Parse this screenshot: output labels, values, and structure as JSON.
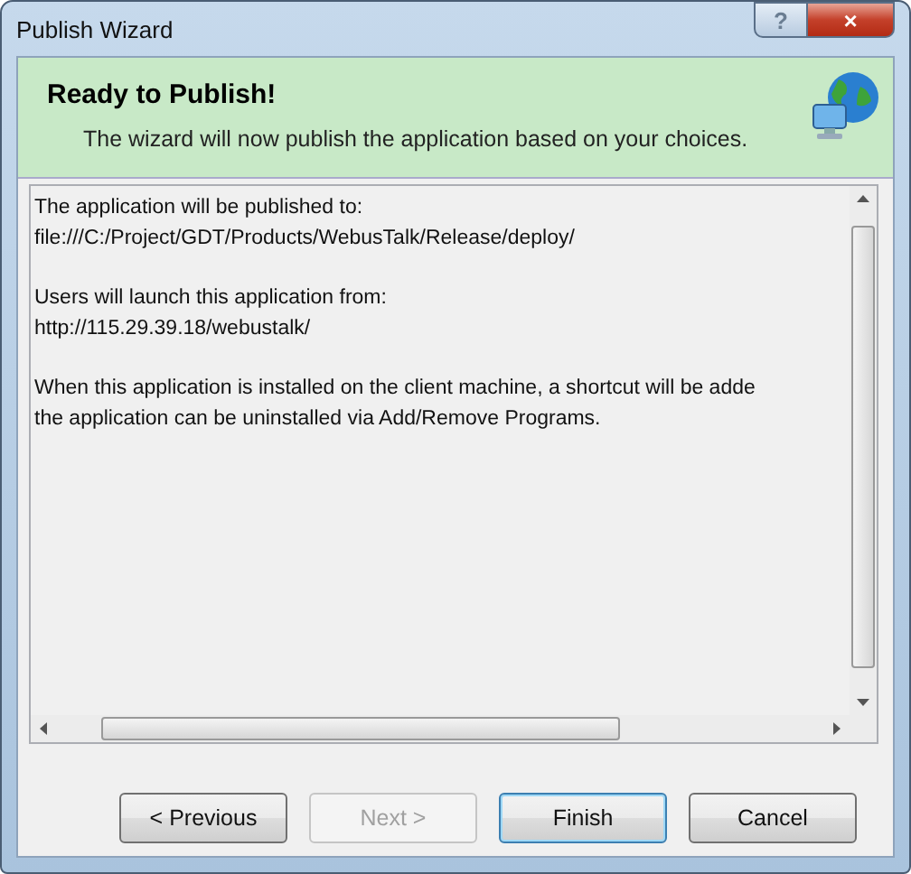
{
  "window": {
    "title": "Publish Wizard",
    "help_button": "?",
    "close_button": "×"
  },
  "header": {
    "title": "Ready to Publish!",
    "subtitle": "The wizard will now publish the application based on your choices."
  },
  "summary": {
    "paragraphs": [
      {
        "lines": [
          "The application will be published to:",
          "file:///C:/Project/GDT/Products/WebusTalk/Release/deploy/"
        ]
      },
      {
        "lines": [
          "Users will launch this application from:",
          "http://115.29.39.18/webustalk/"
        ]
      },
      {
        "lines": [
          "When this application is installed on the client machine, a shortcut will be adde",
          "the application can be uninstalled via Add/Remove Programs."
        ]
      }
    ]
  },
  "buttons": [
    {
      "label": "< Previous",
      "disabled": false,
      "default": false
    },
    {
      "label": "Next >",
      "disabled": true,
      "default": false
    },
    {
      "label": "Finish",
      "disabled": false,
      "default": true
    },
    {
      "label": "Cancel",
      "disabled": false,
      "default": false
    }
  ]
}
